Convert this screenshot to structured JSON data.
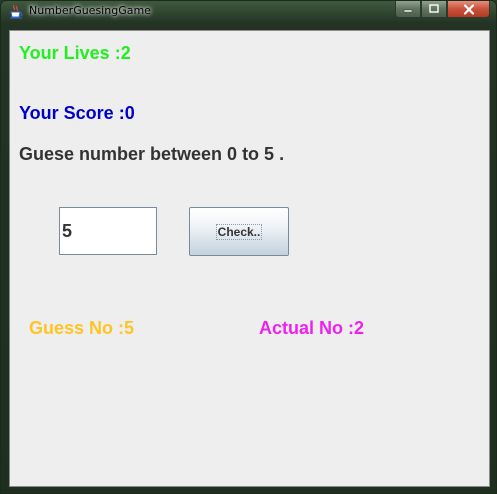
{
  "window": {
    "title": "NumberGuesingGame",
    "icon": "java-cup-icon"
  },
  "controls": {
    "minimize_icon": "minimize-icon",
    "maximize_icon": "maximize-icon",
    "close_icon": "close-icon"
  },
  "game": {
    "lives_text": "Your Lives :2",
    "score_text": "Your Score :0",
    "prompt_text": "Guese number between 0 to 5 .",
    "input_value": "5",
    "check_label": "Check..",
    "guess_text": "Guess No :5",
    "actual_text": "Actual No :2"
  },
  "colors": {
    "lives": "#22ee22",
    "score": "#0000cc",
    "guess": "#ffc425",
    "actual": "#ee22ee"
  }
}
